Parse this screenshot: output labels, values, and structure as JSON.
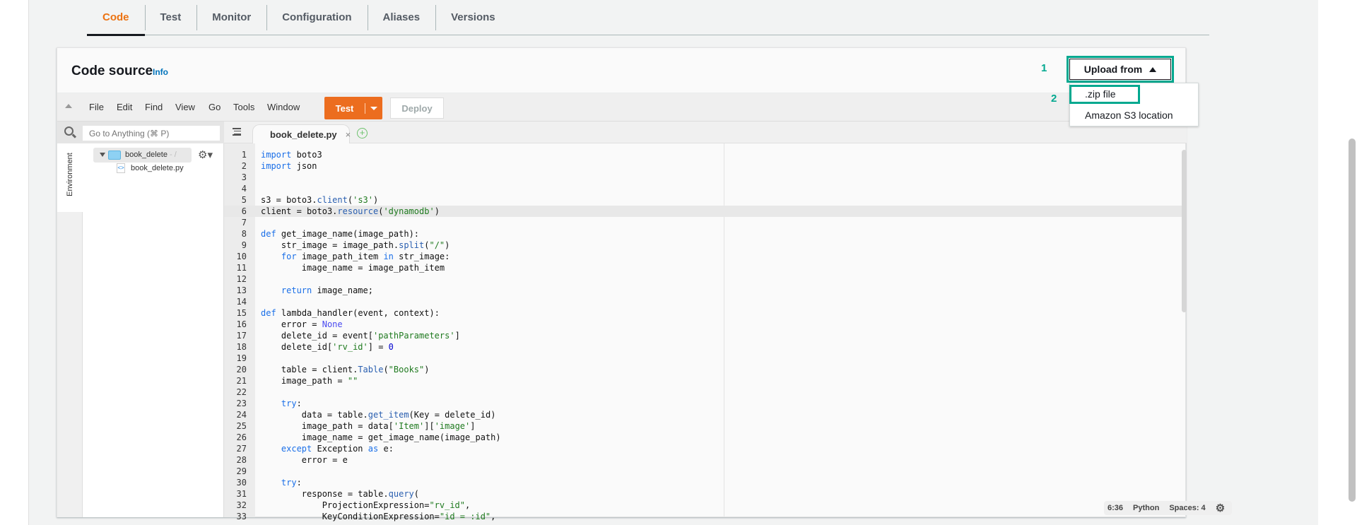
{
  "tabs": [
    {
      "label": "Code",
      "active": true
    },
    {
      "label": "Test"
    },
    {
      "label": "Monitor"
    },
    {
      "label": "Configuration"
    },
    {
      "label": "Aliases"
    },
    {
      "label": "Versions"
    }
  ],
  "panel": {
    "title": "Code source",
    "info": "Info"
  },
  "upload": {
    "label": "Upload from",
    "icon": "caret-up-icon",
    "menu": [
      ".zip file",
      "Amazon S3 location"
    ],
    "step1": "1",
    "step2": "2",
    "highlight_color": "#00a88f"
  },
  "menu": [
    "File",
    "Edit",
    "Find",
    "View",
    "Go",
    "Tools",
    "Window"
  ],
  "toolbar": {
    "test": "Test",
    "deploy": "Deploy",
    "accent": "#ec6d1f"
  },
  "sidebar": {
    "search_placeholder": "Go to Anything (⌘ P)",
    "environment": "Environment",
    "folder": "book_delete",
    "folder_suffix": " - /",
    "file": "book_delete.py"
  },
  "editor": {
    "tab": "book_delete.py",
    "close": "×",
    "add": "+",
    "active_line": 6,
    "lines": [
      "import boto3",
      "import json",
      "",
      "",
      "s3 = boto3.client('s3')",
      "client = boto3.resource('dynamodb')",
      "",
      "def get_image_name(image_path):",
      "    str_image = image_path.split(\"/\")",
      "    for image_path_item in str_image:",
      "        image_name = image_path_item",
      "",
      "    return image_name;",
      "",
      "def lambda_handler(event, context):",
      "    error = None",
      "    delete_id = event['pathParameters']",
      "    delete_id['rv_id'] = 0",
      "",
      "    table = client.Table(\"Books\")",
      "    image_path = \"\"",
      "",
      "    try:",
      "        data = table.get_item(Key = delete_id)",
      "        image_path = data['Item']['image']",
      "        image_name = get_image_name(image_path)",
      "    except Exception as e:",
      "        error = e",
      "",
      "    try:",
      "        response = table.query(",
      "            ProjectionExpression=\"rv_id\",",
      "            KeyConditionExpression=\"id = :id\","
    ]
  },
  "status": {
    "position": "6:36",
    "language": "Python",
    "spaces": "Spaces: 4"
  }
}
